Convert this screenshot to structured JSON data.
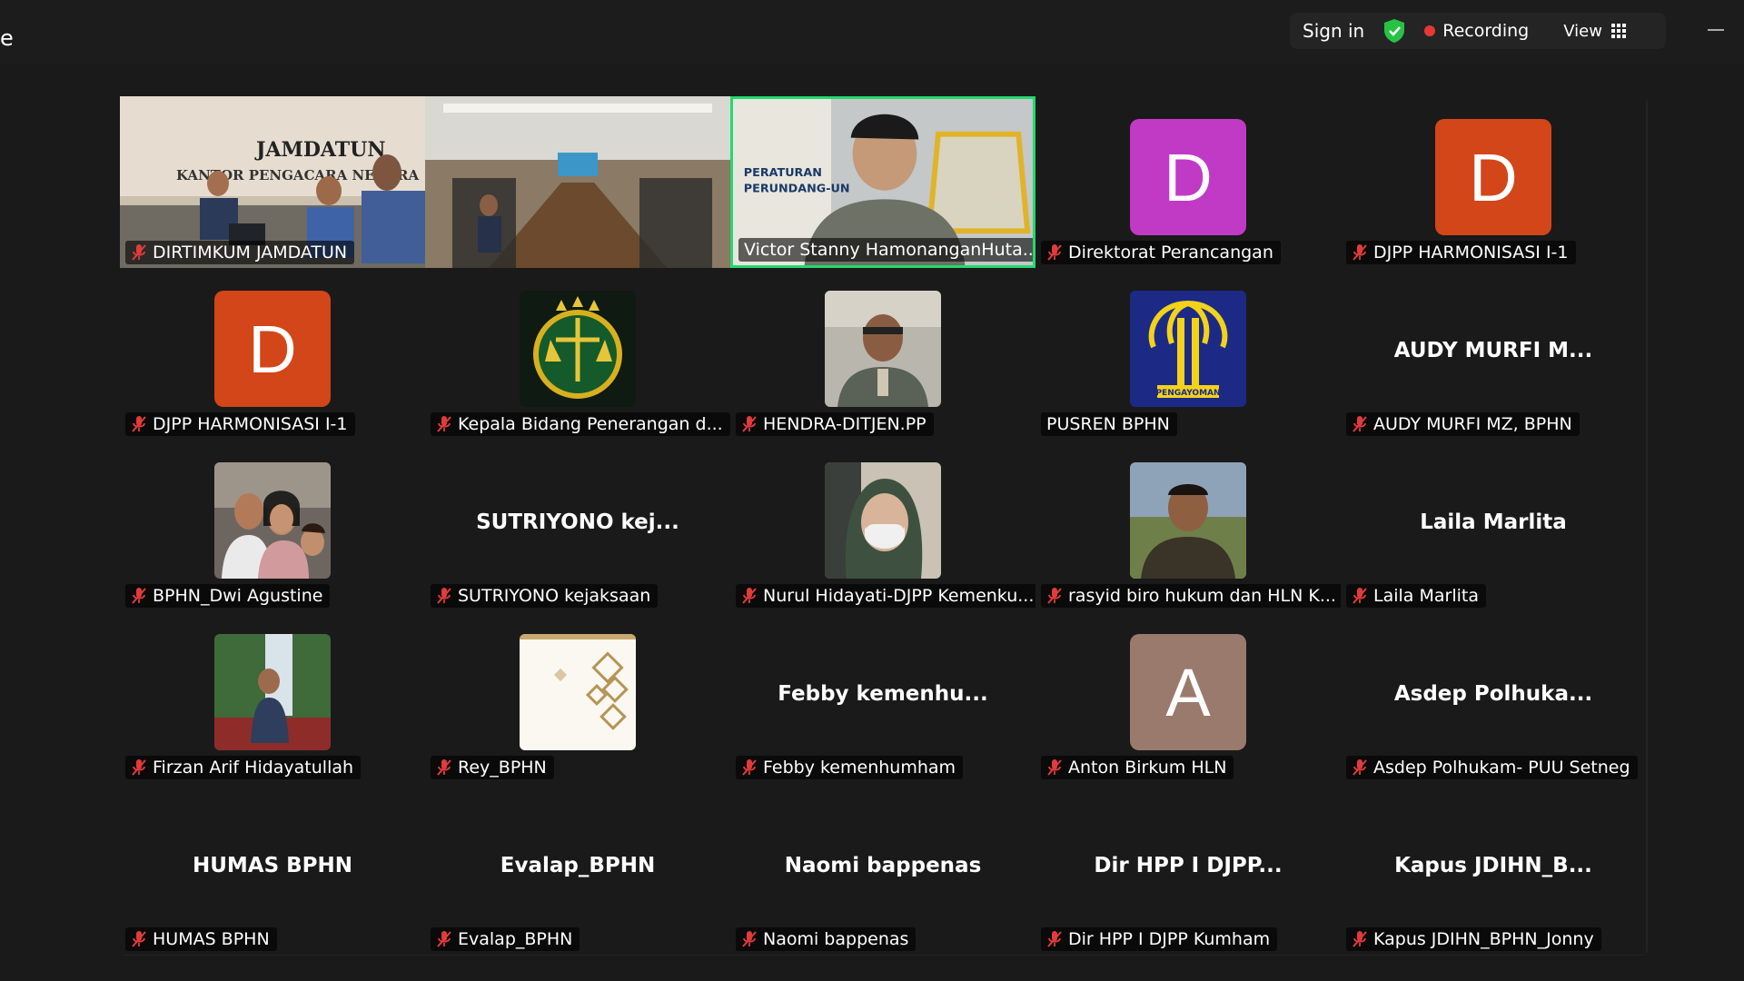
{
  "window": {
    "title_fragment": "e"
  },
  "top_controls": {
    "sign_in": "Sign in",
    "recording": "Recording",
    "view": "View"
  },
  "colors": {
    "active_speaker_border": "#23d96e",
    "recording_dot": "#e53935",
    "shield": "#27c244"
  },
  "participants": [
    {
      "name": "DIRTIMKUM JAMDATUN",
      "tile": "video",
      "muted": true,
      "video_text": {
        "line1": "JAMDATUN",
        "line2": "KANTOR PENGACARA NEGARA"
      }
    },
    {
      "name": "",
      "tile": "video",
      "muted": false
    },
    {
      "name": "Victor Stanny HamonanganHuta...",
      "tile": "video",
      "muted": false,
      "active": true,
      "video_text": {
        "line1": "PERATURAN",
        "line2": "PERUNDANG-UN"
      }
    },
    {
      "name": "Direktorat Perancangan",
      "tile": "avatar",
      "initial": "D",
      "avatar_color": "#c03ac6",
      "muted": true
    },
    {
      "name": "DJPP HARMONISASI I-1",
      "tile": "avatar",
      "initial": "D",
      "avatar_color": "#d2461a",
      "muted": true
    },
    {
      "name": "DJPP HARMONISASI I-1",
      "tile": "avatar",
      "initial": "D",
      "avatar_color": "#d2461a",
      "muted": true
    },
    {
      "name": "Kepala Bidang Penerangan d...",
      "tile": "photo",
      "photo": "emblem-kejaksaan",
      "muted": true
    },
    {
      "name": "HENDRA-DITJEN.PP",
      "tile": "photo",
      "photo": "man-uniform",
      "muted": true
    },
    {
      "name": "PUSREN BPHN",
      "tile": "photo",
      "photo": "pengayoman-logo",
      "muted": false,
      "logo_text": "PENGAYOMAN"
    },
    {
      "name": "AUDY MURFI MZ, BPHN",
      "tile": "text",
      "display_name": "AUDY MURFI M...",
      "muted": true
    },
    {
      "name": "BPHN_Dwi Agustine",
      "tile": "photo",
      "photo": "family-selfie",
      "muted": true
    },
    {
      "name": "SUTRIYONO  kejaksaan",
      "tile": "text",
      "display_name": "SUTRIYONO  kej...",
      "muted": true
    },
    {
      "name": "Nurul Hidayati-DJPP Kemenku...",
      "tile": "photo",
      "photo": "woman-hijab-mask",
      "muted": true
    },
    {
      "name": "rasyid biro hukum dan HLN K...",
      "tile": "photo",
      "photo": "man-outdoor",
      "muted": true
    },
    {
      "name": "Laila Marlita",
      "tile": "text",
      "display_name": "Laila Marlita",
      "muted": true
    },
    {
      "name": "Firzan Arif Hidayatullah",
      "tile": "photo",
      "photo": "man-waterfall",
      "muted": true
    },
    {
      "name": "Rey_BPHN",
      "tile": "photo",
      "photo": "pattern-card",
      "muted": true
    },
    {
      "name": "Febby kemenhumham",
      "tile": "text",
      "display_name": "Febby  kemenhu...",
      "muted": true
    },
    {
      "name": "Anton Birkum HLN",
      "tile": "avatar",
      "initial": "A",
      "avatar_color": "#9a7a6d",
      "muted": true
    },
    {
      "name": "Asdep Polhukam- PUU Setneg",
      "tile": "text",
      "display_name": "Asdep  Polhuka...",
      "muted": true
    },
    {
      "name": "HUMAS BPHN",
      "tile": "text",
      "display_name": "HUMAS BPHN",
      "muted": true
    },
    {
      "name": "Evalap_BPHN",
      "tile": "text",
      "display_name": "Evalap_BPHN",
      "muted": true
    },
    {
      "name": "Naomi bappenas",
      "tile": "text",
      "display_name": "Naomi bappenas",
      "muted": true
    },
    {
      "name": "Dir HPP I DJPP Kumham",
      "tile": "text",
      "display_name": "Dir HPP I DJPP...",
      "muted": true
    },
    {
      "name": "Kapus JDIHN_BPHN_Jonny",
      "tile": "text",
      "display_name": "Kapus  JDIHN_B...",
      "muted": true
    }
  ]
}
